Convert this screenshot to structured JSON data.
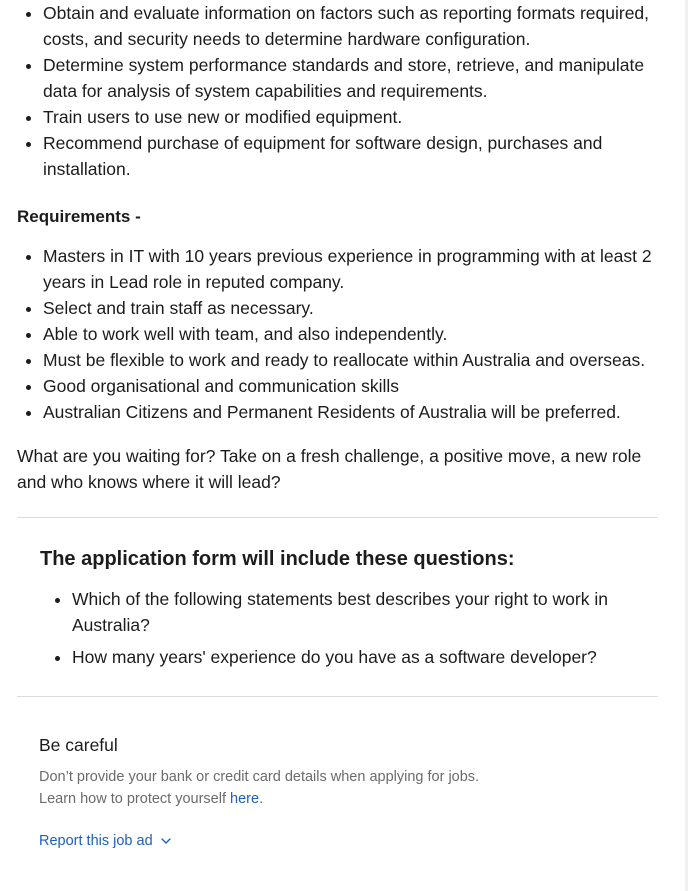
{
  "duties": [
    "Obtain and evaluate information on factors such as reporting formats required, costs, and security needs to determine hardware configuration.",
    "Determine system performance standards and store, retrieve, and manipulate data for analysis of system capabilities and requirements.",
    "Train users to use new or modified equipment.",
    "Recommend purchase of equipment for software design, purchases and installation."
  ],
  "requirements": {
    "heading": "Requirements -",
    "items": [
      "Masters in IT with 10 years previous experience in programming with at least 2 years in Lead role in reputed company.",
      "Select and train staff as necessary.",
      "Able to work well with team, and also independently.",
      "Must be flexible to work and ready to reallocate within Australia and overseas.",
      "Good organisational and communication skills",
      "Australian Citizens and Permanent Residents of Australia will be preferred."
    ]
  },
  "closing": "What are you waiting for? Take on a fresh challenge, a positive move, a new role and who knows where it will lead?",
  "application": {
    "title": "The application form will include these questions:",
    "questions": [
      "Which of the following statements best describes your right to work in Australia?",
      "How many years' experience do you have as a software developer?"
    ]
  },
  "careful": {
    "title": "Be careful",
    "line1": "Don’t provide your bank or credit card details when applying for jobs.",
    "line2_prefix": "Learn how to protect yourself ",
    "line2_link": "here",
    "line2_suffix": "."
  },
  "report": {
    "label": "Report this job ad",
    "icon": "chevron-down-icon"
  },
  "colors": {
    "link": "#1d5fbf",
    "muted_text": "#6b6b6b",
    "divider": "#dcdcdc"
  }
}
